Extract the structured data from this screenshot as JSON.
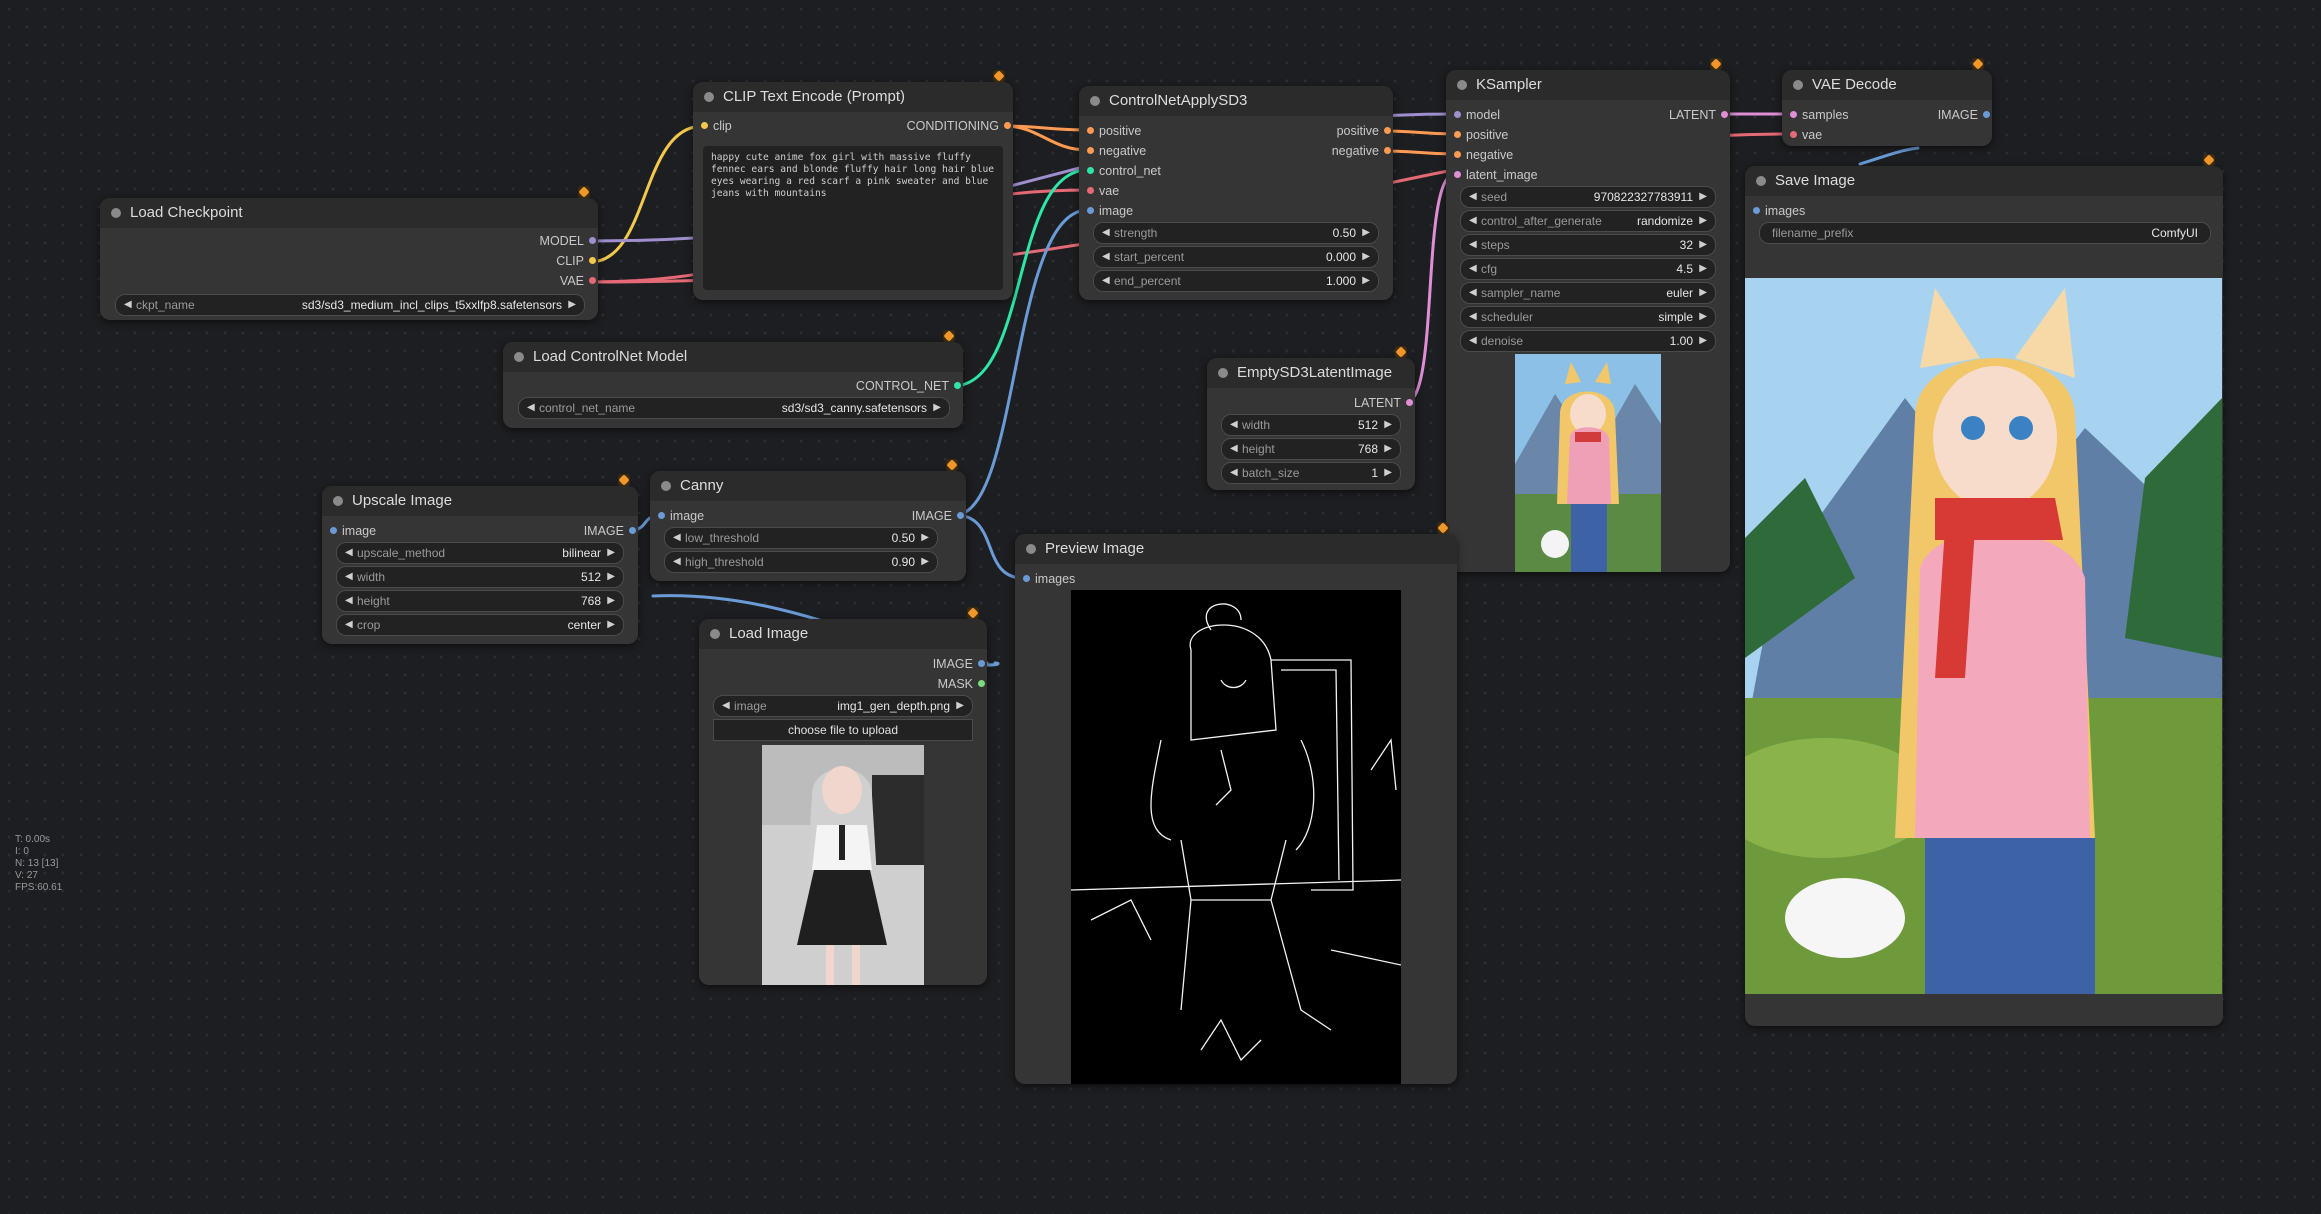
{
  "colors": {
    "clip_link": "#f2c94c",
    "model_link": "#9f8fcf",
    "vae_link": "#e56a76",
    "conditioning_link": "#ff9a52",
    "control_link": "#2ee6a6",
    "image_link": "#6b9bd6",
    "latent_link": "#e08fd7",
    "mask_link": "#7ddc7d"
  },
  "nodes": {
    "load_checkpoint": {
      "title": "Load Checkpoint",
      "outputs": [
        "MODEL",
        "CLIP",
        "VAE"
      ],
      "ckpt_label": "ckpt_name",
      "ckpt_value": "sd3/sd3_medium_incl_clips_t5xxlfp8.safetensors"
    },
    "clip_text": {
      "title": "CLIP Text Encode (Prompt)",
      "input": "clip",
      "output": "CONDITIONING",
      "text": "happy cute anime fox girl with massive fluffy fennec ears and blonde fluffy hair long hair blue eyes wearing a red scarf a pink sweater and blue jeans with mountains"
    },
    "controlnet_loader": {
      "title": "Load ControlNet Model",
      "output": "CONTROL_NET",
      "label": "control_net_name",
      "value": "sd3/sd3_canny.safetensors"
    },
    "controlnet_apply": {
      "title": "ControlNetApplySD3",
      "inputs": [
        "positive",
        "negative",
        "control_net",
        "vae",
        "image"
      ],
      "outputs": [
        "positive",
        "negative"
      ],
      "widgets": [
        {
          "label": "strength",
          "value": "0.50"
        },
        {
          "label": "start_percent",
          "value": "0.000"
        },
        {
          "label": "end_percent",
          "value": "1.000"
        }
      ]
    },
    "ksampler": {
      "title": "KSampler",
      "inputs": [
        "model",
        "positive",
        "negative",
        "latent_image"
      ],
      "output": "LATENT",
      "widgets": [
        {
          "label": "seed",
          "value": "970822327783911"
        },
        {
          "label": "control_after_generate",
          "value": "randomize"
        },
        {
          "label": "steps",
          "value": "32"
        },
        {
          "label": "cfg",
          "value": "4.5"
        },
        {
          "label": "sampler_name",
          "value": "euler"
        },
        {
          "label": "scheduler",
          "value": "simple"
        },
        {
          "label": "denoise",
          "value": "1.00"
        }
      ]
    },
    "vae_decode": {
      "title": "VAE Decode",
      "inputs": [
        "samples",
        "vae"
      ],
      "output": "IMAGE"
    },
    "save_image": {
      "title": "Save Image",
      "input": "images",
      "label": "filename_prefix",
      "value": "ComfyUI"
    },
    "empty_latent": {
      "title": "EmptySD3LatentImage",
      "output": "LATENT",
      "widgets": [
        {
          "label": "width",
          "value": "512"
        },
        {
          "label": "height",
          "value": "768"
        },
        {
          "label": "batch_size",
          "value": "1"
        }
      ]
    },
    "upscale_image": {
      "title": "Upscale Image",
      "input": "image",
      "output": "IMAGE",
      "widgets": [
        {
          "label": "upscale_method",
          "value": "bilinear"
        },
        {
          "label": "width",
          "value": "512"
        },
        {
          "label": "height",
          "value": "768"
        },
        {
          "label": "crop",
          "value": "center"
        }
      ]
    },
    "canny": {
      "title": "Canny",
      "input": "image",
      "output": "IMAGE",
      "widgets": [
        {
          "label": "low_threshold",
          "value": "0.50"
        },
        {
          "label": "high_threshold",
          "value": "0.90"
        }
      ]
    },
    "load_image": {
      "title": "Load Image",
      "outputs": [
        "IMAGE",
        "MASK"
      ],
      "label": "image",
      "value": "img1_gen_depth.png",
      "upload_label": "choose file to upload"
    },
    "preview_image": {
      "title": "Preview Image",
      "input": "images"
    }
  },
  "stats": [
    "T: 0.00s",
    "I: 0",
    "N: 13 [13]",
    "V: 27",
    "FPS:60.61"
  ]
}
